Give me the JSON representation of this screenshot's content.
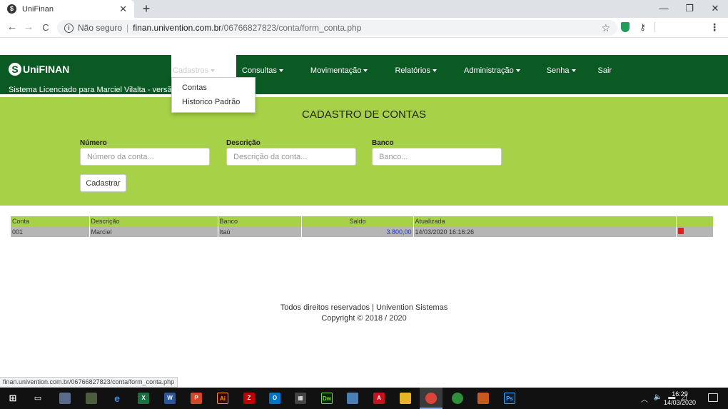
{
  "browser": {
    "tab_title": "UniFinan",
    "tab_close": "✕",
    "new_tab": "+",
    "back": "←",
    "forward": "→",
    "reload": "C",
    "security_label": "Não seguro",
    "url_host": "finan.univention.com.br",
    "url_path": "/06766827823/conta/form_conta.php",
    "minimize": "—",
    "restore": "❐",
    "close": "✕",
    "status_url": "finan.univention.com.br/06766827823/conta/form_conta.php"
  },
  "site": {
    "brand_letter": "S",
    "brand_name": "UniFINAN",
    "license": "Sistema Licenciado para Marciel Vilalta - versão (",
    "menu": [
      {
        "label": "Cadastros"
      },
      {
        "label": "Consultas"
      },
      {
        "label": "Movimentação"
      },
      {
        "label": "Relatórios"
      },
      {
        "label": "Administração"
      },
      {
        "label": "Senha"
      },
      {
        "label": "Sair"
      }
    ],
    "dropdown": [
      "Contas",
      "Historico Padrão"
    ]
  },
  "form": {
    "title": "CADASTRO DE CONTAS",
    "numero_label": "Número",
    "numero_placeholder": "Número da conta...",
    "descricao_label": "Descrição",
    "descricao_placeholder": "Descrição da conta...",
    "banco_label": "Banco",
    "banco_placeholder": "Banco...",
    "submit": "Cadastrar"
  },
  "table": {
    "headers": [
      "Conta",
      "Descrição",
      "Banco",
      "Saldo",
      "Atualizada"
    ],
    "rows": [
      {
        "conta": "001",
        "descricao": "Marciel",
        "banco": "Itaú",
        "saldo": "3.800,00",
        "atualizada": "14/03/2020 16:16:26"
      }
    ]
  },
  "footer": {
    "line1": "Todos direitos reservados | Univention Sistemas",
    "line2": "Copyright © 2018 / 2020"
  },
  "taskbar": {
    "time": "16:29",
    "date": "14/03/2020"
  },
  "colors": {
    "navbar": "#0b5a24",
    "hero": "#a7d147",
    "saldo": "#2433d6",
    "delete": "#e01f1f"
  }
}
